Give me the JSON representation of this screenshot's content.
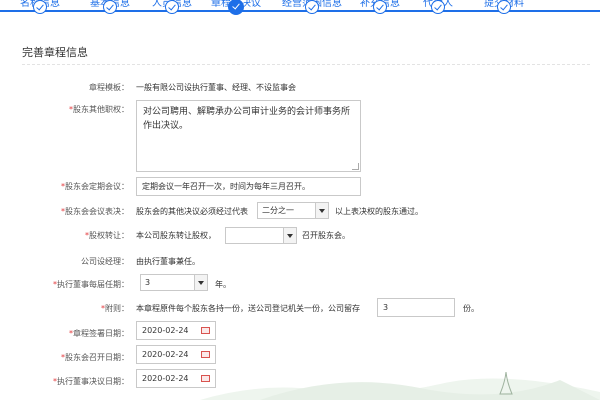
{
  "steps": [
    {
      "label": "名称信息",
      "state": "done"
    },
    {
      "label": "基本信息",
      "state": "done"
    },
    {
      "label": "人员信息",
      "state": "done"
    },
    {
      "label": "章程、决议",
      "state": "current"
    },
    {
      "label": "经营范围信息",
      "state": "done"
    },
    {
      "label": "补充信息",
      "state": "done"
    },
    {
      "label": "代理人",
      "state": "done"
    },
    {
      "label": "提交材料",
      "state": "done"
    }
  ],
  "section_title": "完善章程信息",
  "fields": {
    "template": {
      "label": "章程模板：",
      "value": "一般有限公司设执行董事、经理、不设监事会"
    },
    "other_duties": {
      "label": "股东其他职权：",
      "value": "对公司聘用、解聘承办公司审计业务的会计师事务所作出决议。"
    },
    "meeting": {
      "label": "股东会定期会议：",
      "value": "定期会议一年召开一次，时间为每年三月召开。"
    },
    "vote": {
      "label": "股东会会议表决：",
      "prefix": "股东会的其他决议必须经过代表",
      "select": "二分之一",
      "suffix": "以上表决权的股东通过。"
    },
    "transfer": {
      "label": "股权转让：",
      "prefix": "本公司股东转让股权，",
      "select": "",
      "suffix": "召开股东会。"
    },
    "manager": {
      "label": "公司设经理：",
      "value": "由执行董事兼任。"
    },
    "term": {
      "label": "执行董事每届任期：",
      "select": "3",
      "suffix": "年。"
    },
    "appendix": {
      "label": "附则：",
      "prefix": "本章程原件每个股东各持一份，送公司登记机关一份，公司留存",
      "value": "3",
      "suffix": "份。"
    },
    "sign_date": {
      "label": "章程签署日期：",
      "value": "2020-02-24"
    },
    "meeting_date": {
      "label": "股东会召开日期：",
      "value": "2020-02-24"
    },
    "resolution_date": {
      "label": "执行董事决议日期：",
      "value": "2020-02-24"
    }
  },
  "colors": {
    "accent": "#1e6fe8",
    "required": "#e4393c"
  }
}
